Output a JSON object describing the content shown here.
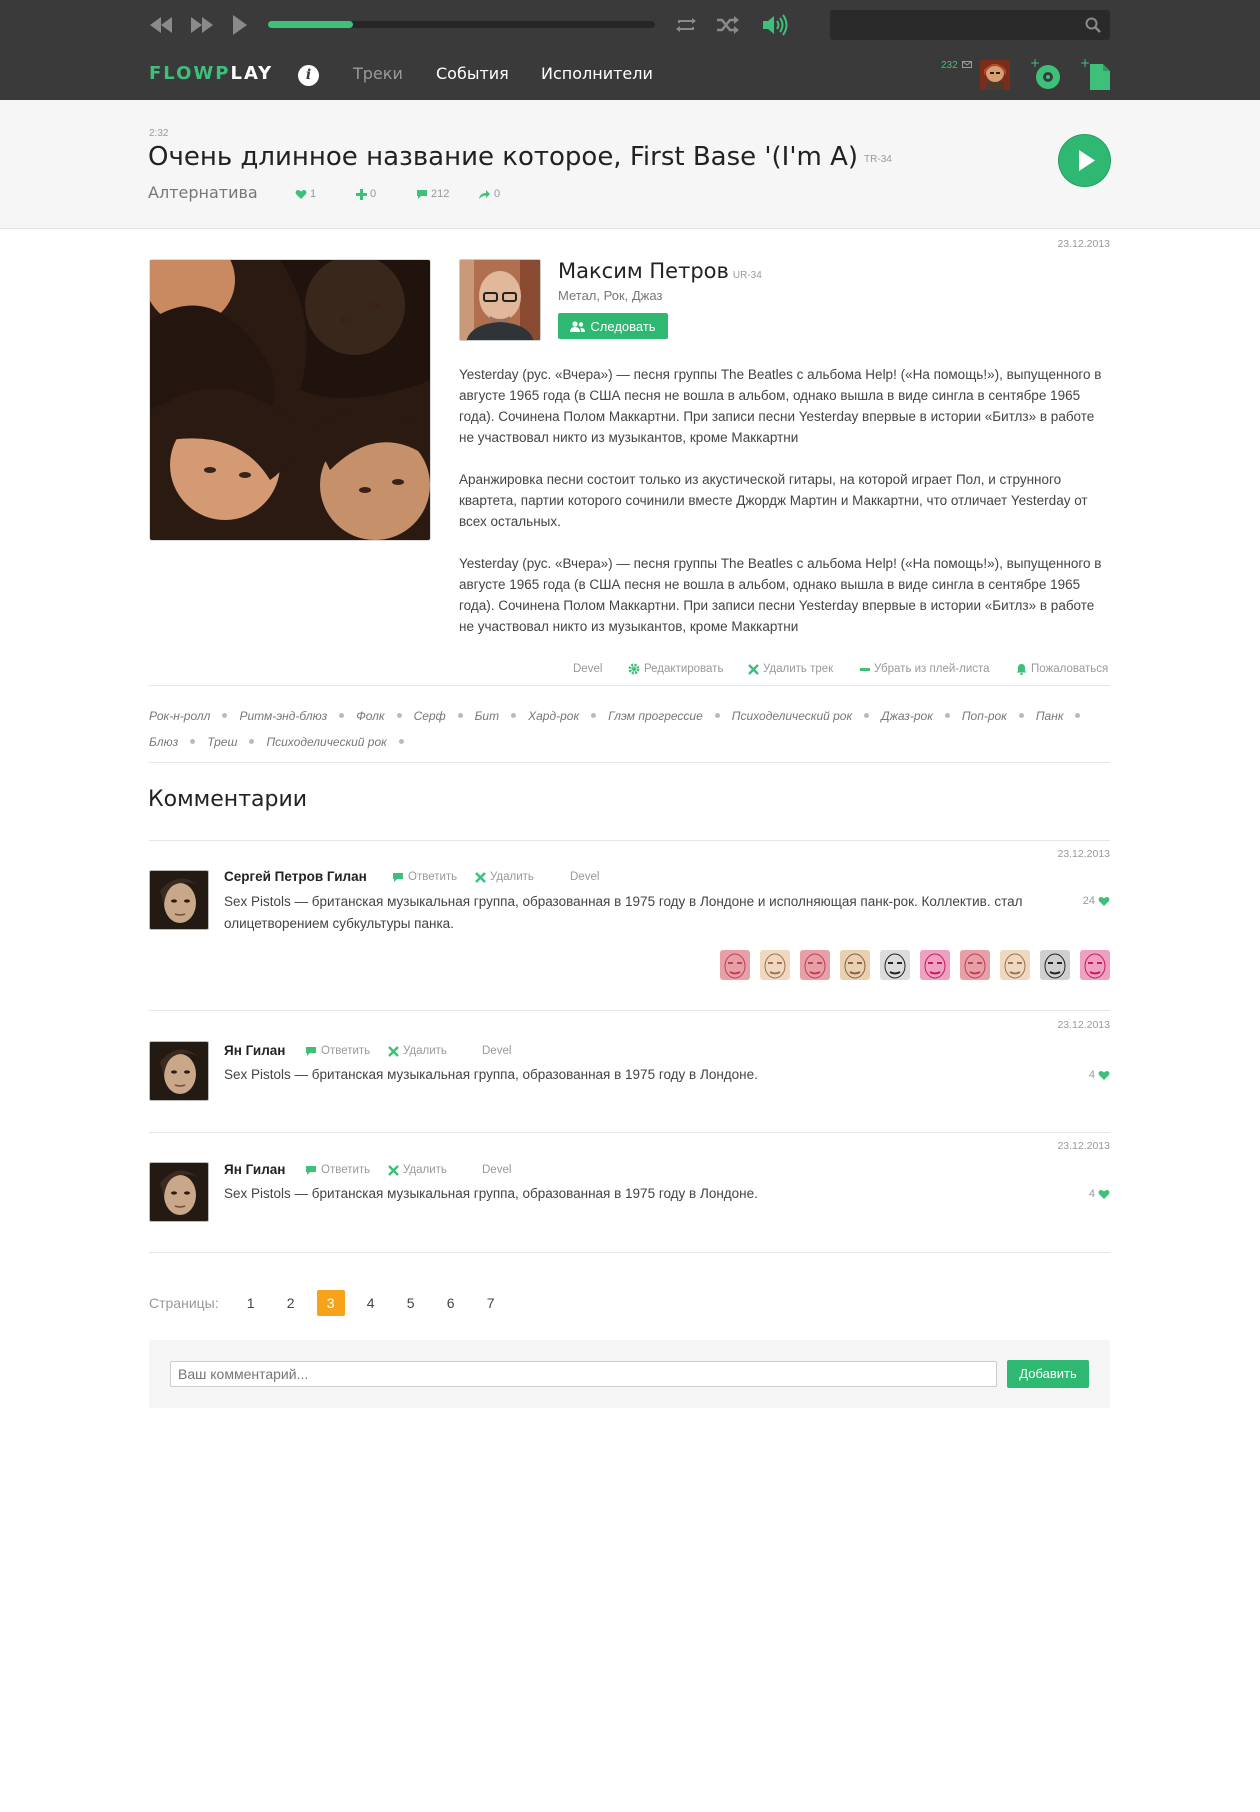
{
  "player": {
    "progress": 0.22
  },
  "brand": {
    "part1": "FLOW",
    "part2": "P",
    "part3": "LAY",
    "accent": "#3ec07a"
  },
  "nav": {
    "info_label": "i",
    "tracks": "Треки",
    "events": "События",
    "artists": "Исполнители"
  },
  "user": {
    "count": "232"
  },
  "track": {
    "duration": "2:32",
    "title": "Очень длинное название которое, First Base '(I'm A)",
    "code": "TR-34",
    "genre": "Алтернатива",
    "likes": "1",
    "adds": "0",
    "comments": "212",
    "shares": "0"
  },
  "post": {
    "date": "23.12.2013",
    "artist_name": "Максим Петров",
    "artist_code": "UR-34",
    "artist_genres": "Метал, Рок, Джаз",
    "follow_label": "Следовать",
    "paragraphs": [
      "Yesterday (рус. «Вчера») — песня группы The Beatles с альбома Help! («На помощь!»), выпущенного в августе 1965 года (в США песня не вошла в альбом, однако вышла в виде сингла в сентябре 1965 года). Сочинена Полом Маккартни. При записи песни Yesterday впервые в истории «Битлз» в работе не участвовал никто из музыкантов, кроме Маккартни",
      "Аранжировка песни состоит только из акустической гитары, на которой играет Пол, и струнного квартета, партии которого сочинили вместе Джордж Мартин и Маккартни, что отличает Yesterday от всех остальных.",
      "Yesterday (рус. «Вчера») — песня группы The Beatles с альбома Help! («На помощь!»), выпущенного в августе 1965 года (в США песня не вошла в альбом, однако вышла в виде сингла в сентябре 1965 года). Сочинена Полом Маккартни. При записи песни Yesterday впервые в истории «Битлз» в работе не участвовал никто из музыкантов, кроме Маккартни"
    ],
    "actions": {
      "devel": "Devel",
      "edit": "Редактировать",
      "delete": "Удалить трек",
      "remove": "Убрать из плей-листа",
      "report": "Пожаловаться"
    }
  },
  "tags": [
    "Рок-н-ролл",
    "Ритм-энд-блюз",
    "Фолк",
    "Серф",
    "Бит",
    "Хард-рок",
    "Глэм прогрессие",
    "Психоделический рок",
    "Джаз-рок",
    "Поп-рок",
    "Панк",
    "Блюз",
    "Треш",
    "Психоделический рок"
  ],
  "comments_title": "Комментарии",
  "comments": [
    {
      "date": "23.12.2013",
      "author": "Сергей Петров Гилан",
      "reply": "Ответить",
      "delete": "Удалить",
      "devel": "Devel",
      "text": "Sex Pistols  — британская музыкальная группа, образованная в 1975 году в Лондоне и исполняющая панк-рок. Коллектив. стал олицетворением субкультуры панка.",
      "likes": "24"
    },
    {
      "date": "23.12.2013",
      "author": "Ян Гилан",
      "reply": "Ответить",
      "delete": "Удалить",
      "devel": "Devel",
      "text": "Sex Pistols  — британская музыкальная группа, образованная в 1975 году в Лондоне.",
      "likes": "4"
    },
    {
      "date": "23.12.2013",
      "author": "Ян Гилан",
      "reply": "Ответить",
      "delete": "Удалить",
      "devel": "Devel",
      "text": "Sex Pistols  — британская музыкальная группа, образованная в 1975 году в Лондоне.",
      "likes": "4"
    }
  ],
  "pagination": {
    "label": "Страницы:",
    "pages": [
      "1",
      "2",
      "3",
      "4",
      "5",
      "6",
      "7"
    ],
    "current": "3"
  },
  "comment_form": {
    "placeholder": "Ваш комментарий...",
    "submit": "Добавить"
  }
}
